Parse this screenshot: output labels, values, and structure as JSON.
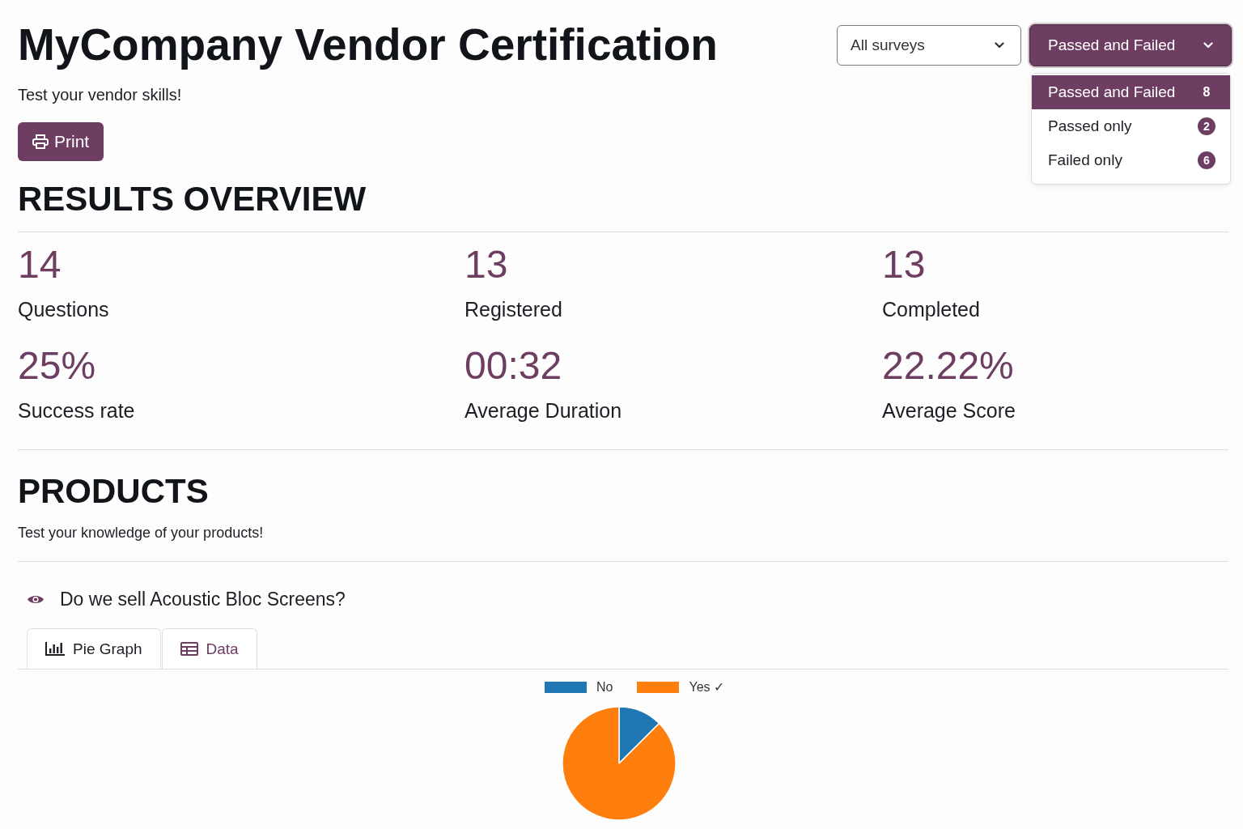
{
  "header": {
    "title": "MyCompany Vendor Certification",
    "subtitle": "Test your vendor skills!",
    "print_button": "Print"
  },
  "filters": {
    "survey_select": {
      "value": "All surveys"
    },
    "result_select": {
      "value": "Passed and Failed",
      "expanded": true,
      "options": [
        {
          "label": "Passed and Failed",
          "count": "8",
          "selected": true
        },
        {
          "label": "Passed only",
          "count": "2",
          "selected": false
        },
        {
          "label": "Failed only",
          "count": "6",
          "selected": false
        }
      ]
    }
  },
  "overview": {
    "heading": "RESULTS OVERVIEW",
    "stats": [
      {
        "value": "14",
        "label": "Questions"
      },
      {
        "value": "13",
        "label": "Registered"
      },
      {
        "value": "13",
        "label": "Completed"
      },
      {
        "value": "25%",
        "label": "Success rate"
      },
      {
        "value": "00:32",
        "label": "Average Duration"
      },
      {
        "value": "22.22%",
        "label": "Average Score"
      }
    ]
  },
  "section": {
    "title": "PRODUCTS",
    "description": "Test your knowledge of your products!",
    "questions": [
      {
        "text": "Do we sell Acoustic Bloc Screens?",
        "tabs": [
          {
            "label": "Pie Graph",
            "kind": "graph",
            "selected": true
          },
          {
            "label": "Data",
            "kind": "table",
            "selected": false
          }
        ],
        "chart_data": {
          "type": "pie",
          "legend": "top",
          "categories": [
            "No",
            "Yes ✓"
          ],
          "values": [
            12.5,
            87.5
          ],
          "colors": [
            "#1f77b4",
            "#ff7f0e"
          ]
        }
      }
    ]
  }
}
